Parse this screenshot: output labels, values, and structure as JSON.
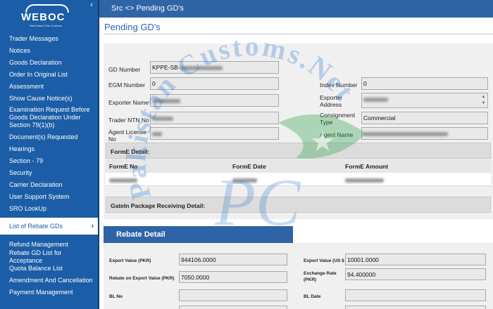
{
  "sidebar": {
    "logo_text": "WEBOC",
    "logo_subtitle": "Web Based One Customs",
    "collapse_icon": "‹",
    "items": [
      {
        "label": "Trader Messages"
      },
      {
        "label": "Notices"
      },
      {
        "label": "Goods Declaration"
      },
      {
        "label": "Order In Original List"
      },
      {
        "label": "Assessment"
      },
      {
        "label": "Show Cause Notice(s)"
      },
      {
        "label": "Examination Request Before Goods Declaration Under Section 79(1)(b)"
      },
      {
        "label": "Document(s) Requested"
      },
      {
        "label": "Hearings"
      },
      {
        "label": "Section - 79"
      },
      {
        "label": "Security"
      },
      {
        "label": "Carrier Declaration"
      },
      {
        "label": "User Support System"
      },
      {
        "label": "SRO LookUp"
      },
      {
        "label": "List of Rebate GDs",
        "active": true
      },
      {
        "label": "Refund Management"
      },
      {
        "label": "Rebate GD List for Acceptance"
      },
      {
        "label": "Quota Balance List"
      },
      {
        "label": "Amendment And Cancellation"
      },
      {
        "label": "Payment Management"
      }
    ]
  },
  "header": {
    "breadcrumb": "Src <> Pending GD's"
  },
  "page": {
    "title": "Pending GD's"
  },
  "form": {
    "gd_number_label": "GD Number",
    "gd_number_value": "KPPE-SB-",
    "egm_number_label": "EGM Number",
    "egm_number_value": "0",
    "index_number_label": "Index Number",
    "index_number_value": "0",
    "exporter_name_label": "Exporter Name",
    "exporter_address_label": "Exporter Address",
    "trader_ntn_label": "Trader NTN No",
    "consignment_type_label": "Consignment Type",
    "consignment_type_value": "Commercial",
    "agent_license_label": "Agent License No",
    "agent_name_label": "Agent Name"
  },
  "forme": {
    "section_title": "FormE Detail:",
    "columns": [
      "FormE No",
      "FormE Date",
      "FormE Amount"
    ]
  },
  "gatein": {
    "section_title": "GateIn Package Receiving Detail:"
  },
  "rebate": {
    "title": "Rebate Detail",
    "export_value_pkr_label": "Export Value (PKR)",
    "export_value_pkr": "944106.0000",
    "export_value_usd_label": "Export Value (US $",
    "export_value_usd": "10001.0000",
    "rebate_label": "Rebate on Export Value (PKR)",
    "rebate_value": "7050.0000",
    "exchange_rate_label": "Exchange Rate (PKR)",
    "exchange_rate": "94.400000",
    "bl_no_label": "BL No",
    "bl_date_label": "BL Date"
  },
  "watermark": {
    "text": "Pakistan Customs.Net",
    "monogram": "PC"
  }
}
